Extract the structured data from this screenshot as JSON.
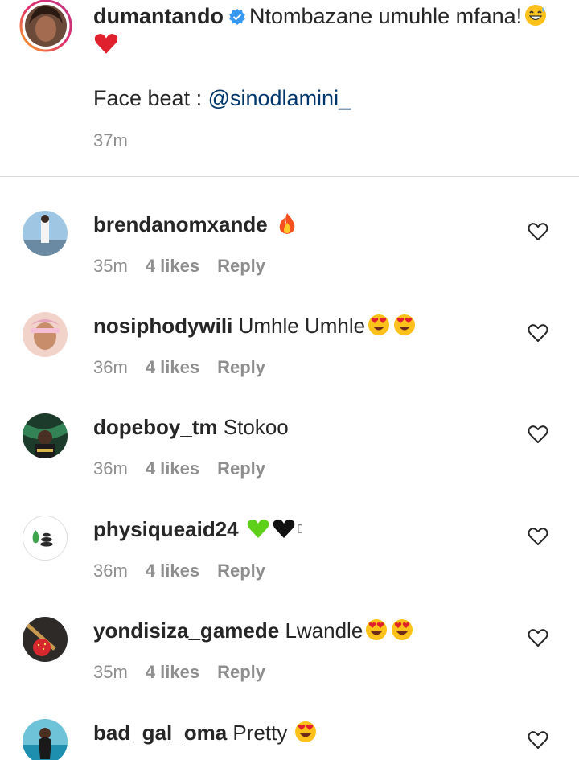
{
  "caption": {
    "username": "dumantando",
    "text": "Ntombazane umuhle mfana!",
    "line2_prefix": "Face beat : ",
    "mention": "@sinodlamini_",
    "time": "37m"
  },
  "comments": [
    {
      "username": "brendanomxande",
      "text": "",
      "time": "35m",
      "likes": "4 likes",
      "reply": "Reply",
      "emojis": "fire"
    },
    {
      "username": "nosiphodywili",
      "text": "Umhle Umhle",
      "time": "36m",
      "likes": "4 likes",
      "reply": "Reply",
      "emojis": "heart-eyes x2"
    },
    {
      "username": "dopeboy_tm",
      "text": "Stokoo",
      "time": "36m",
      "likes": "4 likes",
      "reply": "Reply",
      "emojis": ""
    },
    {
      "username": "physiqueaid24",
      "text": "",
      "time": "36m",
      "likes": "4 likes",
      "reply": "Reply",
      "emojis": "green-heart, black-heart"
    },
    {
      "username": "yondisiza_gamede",
      "text": "Lwandle",
      "time": "35m",
      "likes": "4 likes",
      "reply": "Reply",
      "emojis": "heart-eyes x2"
    },
    {
      "username": "bad_gal_oma",
      "text": "Pretty",
      "time": "",
      "likes": "",
      "reply": "",
      "emojis": "heart-eyes"
    }
  ],
  "colors": {
    "text": "#262626",
    "secondary": "#8e8e8e",
    "mention": "#00376b",
    "verified": "#3897f0",
    "divider": "#dbdbdb"
  },
  "icons": [
    "verified-badge-icon",
    "heart-outline-icon",
    "fire-emoji",
    "heart-eyes-emoji",
    "red-heart-emoji",
    "sweat-smile-emoji",
    "green-heart-emoji",
    "black-heart-emoji"
  ]
}
